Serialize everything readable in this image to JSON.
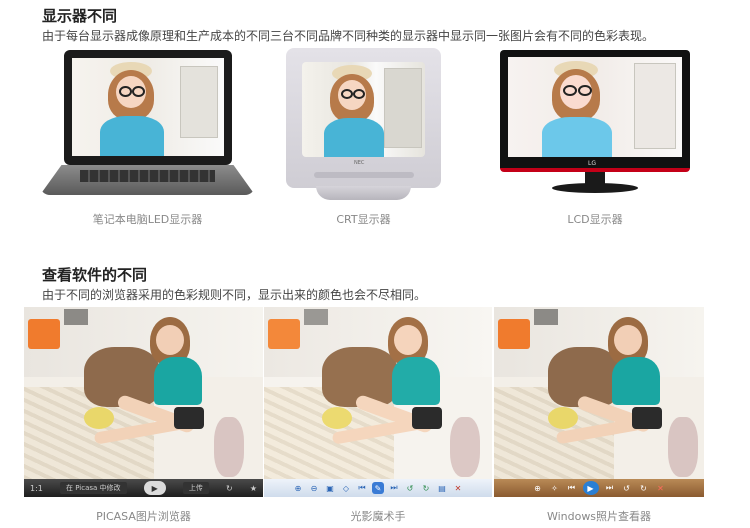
{
  "section1": {
    "title": "显示器不同",
    "desc": "由于每台显示器成像原理和生产成本的不同三台不同品牌不同种类的显示器中显示同一张图片会有不同的色彩表现。",
    "devices": [
      {
        "caption": "笔记本电脑LED显示器"
      },
      {
        "caption": "CRT显示器"
      },
      {
        "caption": "LCD显示器"
      }
    ],
    "crt_brand": "NEC",
    "lcd_brand": "LG"
  },
  "section2": {
    "title": "查看软件的不同",
    "desc": "由于不同的浏览器采用的色彩规则不同，显示出来的颜色也会不尽相同。",
    "viewers": [
      {
        "caption": "PICASA图片浏览器",
        "toolbar_text": "在 Picasa 中修改",
        "zoom_text": "1:1",
        "upload_text": "上传"
      },
      {
        "caption": "光影魔术手"
      },
      {
        "caption": "Windows照片查看器"
      }
    ]
  }
}
